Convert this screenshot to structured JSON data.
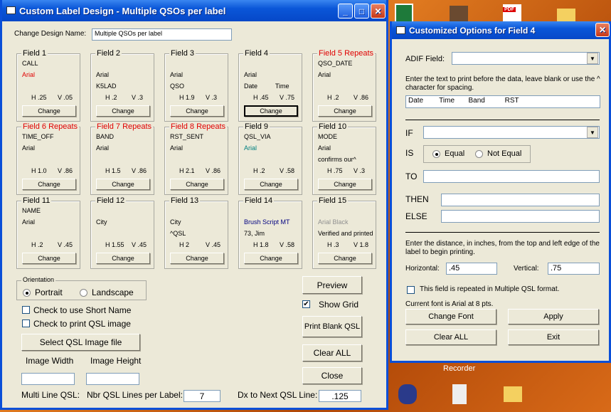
{
  "main": {
    "title": "Custom Label Design - Multiple QSOs per label",
    "design_name_label": "Change Design Name:",
    "design_name_value": "Multiple QSOs per label",
    "change_label": "Change",
    "fields": [
      {
        "title": "Field 1",
        "repeats": false,
        "l1": "CALL",
        "l2": "Arial",
        "l2color": "#e00000",
        "l3": "",
        "h": "H .25",
        "v": "V .05"
      },
      {
        "title": "Field 2",
        "repeats": false,
        "l1": "",
        "l2": "Arial",
        "l3": "K5LAD",
        "h": "H .2",
        "v": "V .3"
      },
      {
        "title": "Field 3",
        "repeats": false,
        "l1": "",
        "l2": "Arial",
        "l3": "QSO",
        "h": "H 1.9",
        "v": "V .3"
      },
      {
        "title": "Field 4",
        "repeats": false,
        "l1": "",
        "l2": "Arial",
        "l3": "Date          Time",
        "h": "H .45",
        "v": "V .75",
        "focused": true
      },
      {
        "title": "Field 5 Repeats",
        "repeats": true,
        "l1": "QSO_DATE",
        "l2": "Arial",
        "l3": "",
        "h": "H .2",
        "v": "V .86"
      },
      {
        "title": "Field 6 Repeats",
        "repeats": true,
        "l1": "TIME_OFF",
        "l2": "Arial",
        "l3": "",
        "h": "H 1.0",
        "v": "V .86"
      },
      {
        "title": "Field 7 Repeats",
        "repeats": true,
        "l1": "BAND",
        "l2": "Arial",
        "l3": "",
        "h": "H 1.5",
        "v": "V .86"
      },
      {
        "title": "Field 8 Repeats",
        "repeats": true,
        "l1": "RST_SENT",
        "l2": "Arial",
        "l3": "",
        "h": "H 2.1",
        "v": "V .86"
      },
      {
        "title": "Field 9",
        "repeats": false,
        "l1": "QSL_VIA",
        "l2": "Arial",
        "l2color": "#008080",
        "l3": "",
        "h": "H .2",
        "v": "V .58"
      },
      {
        "title": "Field 10",
        "repeats": false,
        "l1": "MODE",
        "l2": "Arial",
        "l3": "confirms our^",
        "h": "H .75",
        "v": "V .3"
      },
      {
        "title": "Field 11",
        "repeats": false,
        "l1": "NAME",
        "l2": "Arial",
        "l3": "",
        "h": "H .2",
        "v": "V .45"
      },
      {
        "title": "Field 12",
        "repeats": false,
        "l1": "",
        "l2": "City",
        "l3": "",
        "h": "H 1.55",
        "v": "V .45"
      },
      {
        "title": "Field 13",
        "repeats": false,
        "l1": "",
        "l2": "City",
        "l3": "^QSL",
        "h": "H 2",
        "v": "V .45"
      },
      {
        "title": "Field 14",
        "repeats": false,
        "l1": "",
        "l2": "Brush Script MT",
        "l2color": "#000080",
        "l3": "73, Jim",
        "h": "H 1.8",
        "v": "V .58"
      },
      {
        "title": "Field 15",
        "repeats": false,
        "l1": "",
        "l2": "Arial Black",
        "l2color": "#909090",
        "l3": "Verified and printed",
        "h": "H .3",
        "v": "V 1.8"
      }
    ],
    "orientation": {
      "label": "Orientation",
      "portrait": "Portrait",
      "landscape": "Landscape",
      "selected": "Portrait"
    },
    "short_name": {
      "label": "Check to use Short Name",
      "checked": false
    },
    "print_image": {
      "label": "Check to print QSL image",
      "checked": false
    },
    "select_image": "Select QSL Image file",
    "image_width_label": "Image Width",
    "image_height_label": "Image Height",
    "image_width": "",
    "image_height": "",
    "multi_line_label": "Multi Line QSL:",
    "lines_label": "Nbr QSL Lines per Label:",
    "lines_value": "7",
    "dx_label": "Dx to Next QSL Line:",
    "dx_value": ".125",
    "preview": "Preview",
    "show_grid": {
      "label": "Show Grid",
      "checked": true
    },
    "print_blank": "Print Blank QSL",
    "clear_all": "Clear ALL",
    "close": "Close"
  },
  "dialog": {
    "title": "Customized Options for Field 4",
    "adif_label": "ADIF Field:",
    "adif_value": "",
    "prefix_help": "Enter the text to print before the data, leave blank or use the ^ character for spacing.",
    "prefix_value": "Date        Time       Band          RST",
    "if_label": "IF",
    "if_value": "",
    "is_label": "IS",
    "equal": "Equal",
    "not_equal": "Not Equal",
    "is_selected": "Equal",
    "to_label": "TO",
    "then_label": "THEN",
    "else_label": "ELSE",
    "distance_help": "Enter the distance, in inches, from the top and left edge of the label to begin printing.",
    "horizontal_label": "Horizontal:",
    "horizontal_value": ".45",
    "vertical_label": "Vertical:",
    "vertical_value": ".75",
    "repeat_label": "This field is repeated in Multiple QSL format.",
    "repeat_checked": false,
    "font_info": "Current font is Arial at 8 pts.",
    "change_font": "Change Font",
    "apply": "Apply",
    "clear_all": "Clear ALL",
    "exit": "Exit"
  },
  "desktop": {
    "recorder_label": "Recorder",
    "pdf_badge": "PDF"
  },
  "colors": {
    "titlebar": "#0a56d8",
    "repeat_title": "#e00000",
    "window_bg": "#ece9d8"
  }
}
